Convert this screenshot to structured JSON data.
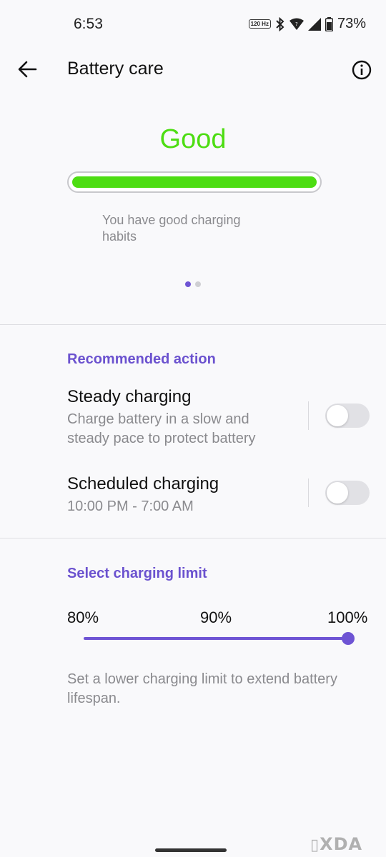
{
  "status_bar": {
    "time": "6:53",
    "rate_badge": "120 Hz",
    "battery_percent": "73%"
  },
  "header": {
    "title": "Battery care",
    "back_icon": "arrow-left-icon",
    "info_icon": "info-circle-icon"
  },
  "health": {
    "status": "Good",
    "status_color": "#4ddd12",
    "bar_fill_fraction": 1.0,
    "description": "You have good charging habits",
    "pages": 2,
    "active_page": 0
  },
  "recommended": {
    "header": "Recommended action",
    "items": [
      {
        "title": "Steady charging",
        "subtitle": "Charge battery in a slow and steady pace to protect battery",
        "enabled": false
      },
      {
        "title": "Scheduled charging",
        "subtitle": "10:00 PM - 7:00 AM",
        "enabled": false
      }
    ]
  },
  "charging_limit": {
    "header": "Select charging limit",
    "options": [
      "80%",
      "90%",
      "100%"
    ],
    "selected": "100%",
    "description": "Set a lower charging limit to extend battery lifespan."
  },
  "watermark": "XDA",
  "accent_color": "#6e54d4"
}
